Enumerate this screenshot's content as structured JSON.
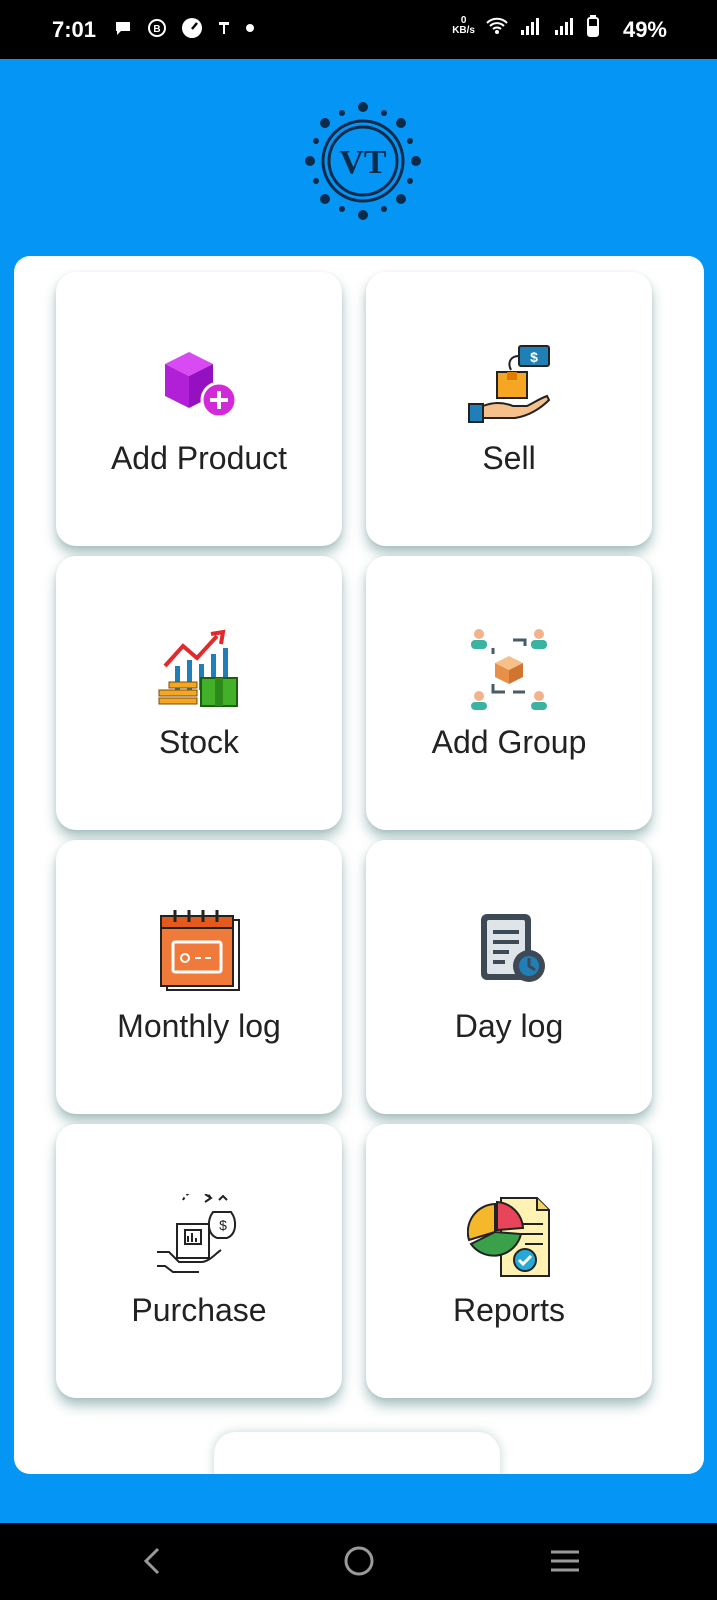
{
  "status_bar": {
    "time": "7:01",
    "speed_value": "0",
    "speed_unit": "KB/s",
    "battery": "49%"
  },
  "logo": {
    "text": "VT"
  },
  "menu": [
    {
      "label": "Add Product",
      "icon": "add-product-icon"
    },
    {
      "label": "Sell",
      "icon": "sell-icon"
    },
    {
      "label": "Stock",
      "icon": "stock-icon"
    },
    {
      "label": "Add Group",
      "icon": "add-group-icon"
    },
    {
      "label": "Monthly log",
      "icon": "monthly-log-icon"
    },
    {
      "label": "Day log",
      "icon": "day-log-icon"
    },
    {
      "label": "Purchase",
      "icon": "purchase-icon"
    },
    {
      "label": "Reports",
      "icon": "reports-icon"
    }
  ],
  "colors": {
    "background": "#0596f5",
    "accent_purple": "#c21ee6",
    "card": "#ffffff"
  }
}
